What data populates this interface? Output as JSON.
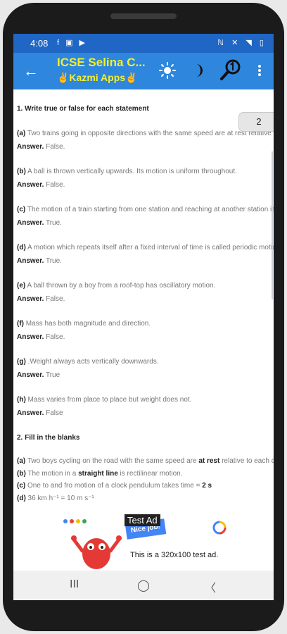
{
  "status": {
    "time": "4:08",
    "left_icons": "f ▣ ▶",
    "right_icons": "ℕ ✕ ◥ ▯"
  },
  "app_bar": {
    "title": "ICSE Selina C...",
    "subtitle": "✌Kazmi Apps✌"
  },
  "page_indicator": "2",
  "content": {
    "lines": [
      {
        "segments": [
          {
            "text": "1. Write true or false for each statement",
            "bold": true
          }
        ],
        "heading": true
      },
      {
        "segments": [
          {
            "text": "(a)",
            "bold": true
          },
          {
            "text": " Two trains going in opposite directions with the same speed are at rest relative to each other."
          }
        ]
      },
      {
        "segments": [
          {
            "text": "Answer.",
            "bold": true
          },
          {
            "text": " False."
          }
        ]
      },
      {
        "segments": [
          {
            "text": "(b)",
            "bold": true
          },
          {
            "text": " A ball is thrown vertically upwards. Its motion is uniform throughout."
          }
        ]
      },
      {
        "segments": [
          {
            "text": "Answer.",
            "bold": true
          },
          {
            "text": " False."
          }
        ]
      },
      {
        "segments": [
          {
            "text": "(c)",
            "bold": true
          },
          {
            "text": " The motion of a train starting from one station and reaching at another station is translatory."
          }
        ]
      },
      {
        "segments": [
          {
            "text": "Answer.",
            "bold": true
          },
          {
            "text": " True."
          }
        ]
      },
      {
        "segments": [
          {
            "text": "(d)",
            "bold": true
          },
          {
            "text": " A motion which repeats itself after a fixed interval of time is called periodic motion."
          }
        ]
      },
      {
        "segments": [
          {
            "text": "Answer.",
            "bold": true
          },
          {
            "text": " True."
          }
        ]
      },
      {
        "segments": [
          {
            "text": "(e)",
            "bold": true
          },
          {
            "text": " A ball thrown by a boy from a roof-top has oscillatory motion."
          }
        ]
      },
      {
        "segments": [
          {
            "text": "Answer.",
            "bold": true
          },
          {
            "text": " False."
          }
        ]
      },
      {
        "segments": [
          {
            "text": "(f)",
            "bold": true
          },
          {
            "text": " Mass has both magnitude and direction."
          }
        ]
      },
      {
        "segments": [
          {
            "text": "Answer.",
            "bold": true
          },
          {
            "text": " False."
          }
        ]
      },
      {
        "segments": [
          {
            "text": "(g)",
            "bold": true
          },
          {
            "text": " .Weight always acts vertically downwards."
          }
        ]
      },
      {
        "segments": [
          {
            "text": "Answer.",
            "bold": true
          },
          {
            "text": " True"
          }
        ]
      },
      {
        "segments": [
          {
            "text": "(h)",
            "bold": true
          },
          {
            "text": " Mass varies from place to place but weight does not."
          }
        ]
      },
      {
        "segments": [
          {
            "text": "Answer.",
            "bold": true
          },
          {
            "text": " False"
          }
        ]
      },
      {
        "segments": [
          {
            "text": "2. Fill in the blanks",
            "bold": true
          }
        ],
        "heading": true
      },
      {
        "segments": [
          {
            "text": "(a)",
            "bold": true
          },
          {
            "text": " Two boys cycling on the road with the same speed are "
          },
          {
            "text": "at rest",
            "bold": true
          },
          {
            "text": " relative to each other."
          }
        ]
      },
      {
        "segments": [
          {
            "text": "(b)",
            "bold": true
          },
          {
            "text": " The motion in a "
          },
          {
            "text": "straight line",
            "bold": true
          },
          {
            "text": " is rectilinear motion."
          }
        ]
      },
      {
        "segments": [
          {
            "text": "(c)",
            "bold": true
          },
          {
            "text": " One to and fro motion of a clock pendulum takes time = "
          },
          {
            "text": "2 s",
            "bold": true
          }
        ]
      },
      {
        "segments": [
          {
            "text": "(d)",
            "bold": true
          },
          {
            "text": " 36 km h⁻¹ = 10 m s⁻¹"
          }
        ]
      }
    ]
  },
  "ad": {
    "tag": "Test Ad",
    "badge": "Nice job!",
    "text": "This is a 320x100 test ad."
  },
  "nav": {
    "recent": "III",
    "home": "◯",
    "back": "〈"
  },
  "colors": {
    "status_bar": "#1f66c5",
    "app_bar": "#2f86dd",
    "title": "#f3ef2f"
  }
}
